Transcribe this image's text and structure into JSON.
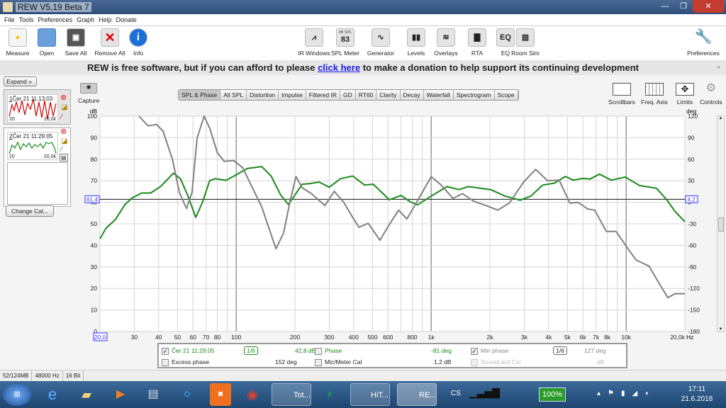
{
  "window": {
    "title": "REW V5,19 Beta 7"
  },
  "menu": [
    "File",
    "Tools",
    "Preferences",
    "Graph",
    "Help",
    "Donate"
  ],
  "toolbar_left": [
    {
      "label": "Measure",
      "icon": "measure-icon"
    },
    {
      "label": "Open",
      "icon": "folder-icon"
    },
    {
      "label": "Save All",
      "icon": "save-icon"
    },
    {
      "label": "Remove All",
      "icon": "remove-icon"
    },
    {
      "label": "Info",
      "icon": "info-icon"
    }
  ],
  "toolbar_mid": [
    {
      "label": "IR Windows",
      "glyph": "⩘"
    },
    {
      "label": "SPL Meter",
      "glyph": "83",
      "sub": "dB SPL"
    },
    {
      "label": "Generator",
      "glyph": "∿"
    },
    {
      "label": "Levels",
      "glyph": "▮▮"
    },
    {
      "label": "Overlays",
      "glyph": "≋"
    },
    {
      "label": "RTA",
      "glyph": "▇"
    },
    {
      "label": "EQ",
      "glyph": "EQ"
    },
    {
      "label": "Room Sim",
      "glyph": "▥"
    }
  ],
  "preferences_label": "Preferences",
  "donate": {
    "before": "REW is free software, but if you can afford to please ",
    "link": "click here",
    "after": " to make a donation to help support its continuing development",
    "close": "×"
  },
  "left_panel": {
    "expand": "Expand",
    "measurements": [
      {
        "num": "1",
        "name": "Čer 21 11:13:03",
        "xmin": "20",
        "xmax": "20,0k",
        "color": "#c00000"
      },
      {
        "num": "2",
        "name": "Čer 21 11:29:05",
        "xmin": "20",
        "xmax": "20,0k",
        "color": "#1a8a1a"
      }
    ],
    "change_cal": "Change Cal..."
  },
  "capture_label": "Capture",
  "tabs": [
    "SPL & Phase",
    "All SPL",
    "Distortion",
    "Impulse",
    "Filtered IR",
    "GD",
    "RT60",
    "Clarity",
    "Decay",
    "Waterfall",
    "Spectrogram",
    "Scope"
  ],
  "selected_tab": "SPL & Phase",
  "right_tools": [
    "Scrollbars",
    "Freq. Axis",
    "Limits",
    "Controls"
  ],
  "legend": {
    "row1": {
      "name": "Čer 21 11:29:05",
      "smoothing": "1/6",
      "value": "42,8 dB",
      "phase_label": "Phase",
      "phase_value": "-81 deg",
      "minphase_label": "Min phase",
      "minphase_smoothing": "1/6",
      "minphase_value": "127 deg"
    },
    "row2": {
      "excess": "Excess phase",
      "excess_value": "152 deg",
      "mic": "Mic/Meter Cal",
      "mic_value": "1,2 dB",
      "soundcard": "Soundcard Cal",
      "soundcard_value": "dB"
    }
  },
  "status": [
    "52/124MB",
    "48000 Hz",
    "16 Bit"
  ],
  "taskbar": {
    "items": [
      "Tot...",
      "HiT...",
      "RE..."
    ],
    "lang": "CS",
    "battery": "100%",
    "time": "17:11",
    "date": "21.6.2018"
  },
  "chart_data": {
    "type": "line",
    "xscale": "log",
    "xlim": [
      20,
      20000
    ],
    "ylim": [
      0,
      100
    ],
    "y2lim": [
      -180,
      120
    ],
    "ylabel": "dB",
    "y2label": "deg",
    "xunit": "Hz",
    "xticks": [
      "20,0",
      "30",
      "40",
      "50",
      "60",
      "70",
      "80",
      "100",
      "200",
      "300",
      "400",
      "500",
      "600",
      "800",
      "1k",
      "2k",
      "3k",
      "4k",
      "5k",
      "6k",
      "7k",
      "8k",
      "10k",
      "20,0k"
    ],
    "xtick_values": [
      20,
      30,
      40,
      50,
      60,
      70,
      80,
      100,
      200,
      300,
      400,
      500,
      600,
      800,
      1000,
      2000,
      3000,
      4000,
      5000,
      6000,
      7000,
      8000,
      10000,
      20000
    ],
    "yticks": [
      0,
      10,
      20,
      30,
      40,
      50,
      60,
      70,
      80,
      90,
      100
    ],
    "y2ticks": [
      -180,
      -150,
      -120,
      -90,
      -60,
      -30,
      0,
      30,
      60,
      90,
      120
    ],
    "cursor": {
      "spl": "61,4",
      "phase": "4,2",
      "spl_value": 61.4
    },
    "grid": true,
    "series": [
      {
        "axis": "left",
        "color": "#1a8a1a",
        "points": [
          [
            20,
            43.1
          ],
          [
            21.5,
            48
          ],
          [
            24,
            52
          ],
          [
            26.9,
            59
          ],
          [
            29.2,
            62
          ],
          [
            32.7,
            64.3
          ],
          [
            36.4,
            64.3
          ],
          [
            40.9,
            67.3
          ],
          [
            47.6,
            73.5
          ],
          [
            51.7,
            71
          ],
          [
            56.3,
            63.4
          ],
          [
            62,
            53
          ],
          [
            67.1,
            60
          ],
          [
            73,
            70
          ],
          [
            78,
            71
          ],
          [
            88.7,
            70.2
          ],
          [
            100,
            72.8
          ],
          [
            114,
            75.7
          ],
          [
            135,
            76.6
          ],
          [
            151,
            72.2
          ],
          [
            169,
            63.4
          ],
          [
            185,
            59
          ],
          [
            200,
            63.4
          ],
          [
            218,
            68.4
          ],
          [
            237,
            68.7
          ],
          [
            266,
            69.4
          ],
          [
            300,
            67
          ],
          [
            343,
            71
          ],
          [
            396,
            72.2
          ],
          [
            455,
            68
          ],
          [
            505,
            68.4
          ],
          [
            610,
            61.2
          ],
          [
            700,
            63.2
          ],
          [
            782,
            60.2
          ],
          [
            850,
            58.8
          ],
          [
            1000,
            62.9
          ],
          [
            1206,
            67.3
          ],
          [
            1386,
            65.9
          ],
          [
            1549,
            67.3
          ],
          [
            2020,
            65.9
          ],
          [
            2390,
            62.9
          ],
          [
            2865,
            61
          ],
          [
            3245,
            62.9
          ],
          [
            3730,
            68
          ],
          [
            4290,
            68.9
          ],
          [
            4870,
            72
          ],
          [
            5360,
            70.3
          ],
          [
            5990,
            71.1
          ],
          [
            6520,
            70.8
          ],
          [
            7300,
            73.1
          ],
          [
            8380,
            70.3
          ],
          [
            9900,
            71.7
          ],
          [
            11700,
            67.8
          ],
          [
            14300,
            66.5
          ],
          [
            16160,
            61.2
          ],
          [
            17800,
            55.8
          ],
          [
            20000,
            51
          ]
        ]
      },
      {
        "axis": "right",
        "color": "#808080",
        "points": [
          [
            31.7,
            120
          ],
          [
            35.3,
            106.5
          ],
          [
            39,
            108.5
          ],
          [
            42.1,
            99.3
          ],
          [
            47.1,
            59.7
          ],
          [
            51.1,
            13.6
          ],
          [
            55.6,
            -8.7
          ],
          [
            59.3,
            13.6
          ],
          [
            63,
            89.4
          ],
          [
            68.4,
            120
          ],
          [
            73.3,
            102.5
          ],
          [
            79.9,
            69.6
          ],
          [
            86.7,
            57.1
          ],
          [
            97,
            58.1
          ],
          [
            108,
            48.2
          ],
          [
            121,
            20.2
          ],
          [
            135,
            -6.1
          ],
          [
            147,
            -35.7
          ],
          [
            160,
            -64.7
          ],
          [
            175,
            -42.3
          ],
          [
            189.5,
            3.8
          ],
          [
            202.5,
            35.7
          ],
          [
            218,
            20.2
          ],
          [
            243,
            12
          ],
          [
            285,
            -4.5
          ],
          [
            318,
            15.3
          ],
          [
            355,
            0.5
          ],
          [
            392,
            -19.3
          ],
          [
            426,
            -34.8
          ],
          [
            475,
            -29.2
          ],
          [
            546,
            -52.9
          ],
          [
            610,
            -30.8
          ],
          [
            680,
            -11
          ],
          [
            750,
            -23.2
          ],
          [
            804,
            -9.4
          ],
          [
            1000,
            35.7
          ],
          [
            1124,
            24.2
          ],
          [
            1293,
            5.5
          ],
          [
            1446,
            12
          ],
          [
            1662,
            1.2
          ],
          [
            1910,
            -4.5
          ],
          [
            2197,
            -11
          ],
          [
            2527,
            -0.5
          ],
          [
            2985,
            28.5
          ],
          [
            3436,
            45.9
          ],
          [
            3946,
            30.1
          ],
          [
            4534,
            30.8
          ],
          [
            5148,
            -1.2
          ],
          [
            5674,
            -0.2
          ],
          [
            6347,
            -9.4
          ],
          [
            6895,
            -11
          ],
          [
            7918,
            -40.7
          ],
          [
            8880,
            -40.7
          ],
          [
            10050,
            -62
          ],
          [
            11220,
            -80.2
          ],
          [
            13100,
            -89
          ],
          [
            14650,
            -111.5
          ],
          [
            16360,
            -132.9
          ],
          [
            17810,
            -127.3
          ],
          [
            20000,
            -127.3
          ]
        ]
      }
    ]
  }
}
